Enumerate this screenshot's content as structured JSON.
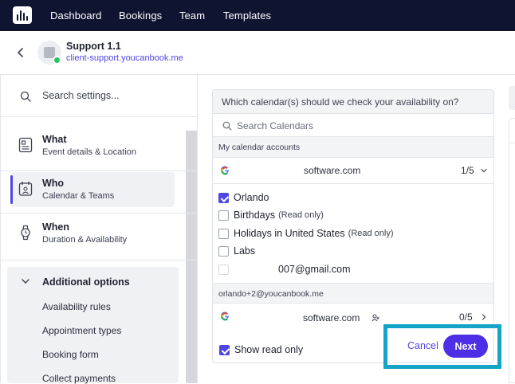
{
  "nav": {
    "items": [
      "Dashboard",
      "Bookings",
      "Team",
      "Templates"
    ]
  },
  "header": {
    "title": "Support 1.1",
    "link": "client-support.youcanbook.me"
  },
  "sidebar": {
    "search_placeholder": "Search settings...",
    "items": [
      {
        "title": "What",
        "subtitle": "Event details & Location",
        "icon": "document-icon"
      },
      {
        "title": "Who",
        "subtitle": "Calendar & Teams",
        "icon": "calendar-user-icon",
        "active": true
      },
      {
        "title": "When",
        "subtitle": "Duration & Availability",
        "icon": "watch-icon"
      }
    ],
    "additional": {
      "title": "Additional options",
      "items": [
        "Availability rules",
        "Appointment types",
        "Booking form",
        "Collect payments"
      ]
    }
  },
  "calendars": {
    "question": "Which calendar(s) should we check your availability on?",
    "search_placeholder": "Search Calendars",
    "group1": {
      "label": "My calendar accounts",
      "account": "software.com",
      "count": "1/5",
      "calendars": [
        {
          "name": "Orlando",
          "note": "",
          "checked": true
        },
        {
          "name": "Birthdays",
          "note": "(Read only)",
          "checked": false
        },
        {
          "name": "Holidays in United States",
          "note": "(Read only)",
          "checked": false
        },
        {
          "name": "Labs",
          "note": "",
          "checked": false
        },
        {
          "name": "007@gmail.com",
          "note": "",
          "checked": false
        }
      ]
    },
    "group2": {
      "label": "orlando+2@youcanbook.me",
      "account": "software.com",
      "count": "0/5"
    },
    "show_read_only": "Show read only",
    "show_read_only_checked": true
  },
  "actions": {
    "cancel": "Cancel",
    "next": "Next"
  },
  "colors": {
    "nav_bg": "#0f1530",
    "accent": "#4f46e5",
    "next_button": "#4f2ee8",
    "highlight": "#14a4c7",
    "status": "#22c55e"
  }
}
